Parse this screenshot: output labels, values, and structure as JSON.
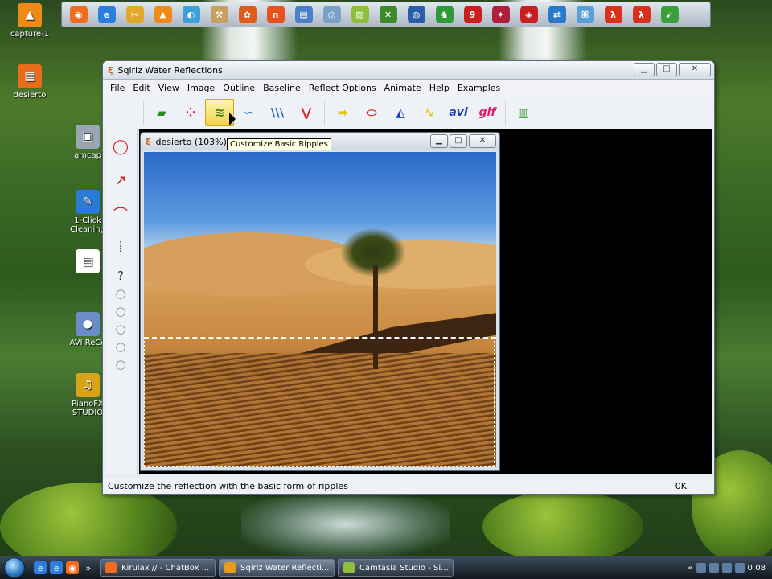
{
  "desktop": {
    "icons": [
      {
        "label": "capture-1",
        "glyph": "▲",
        "color": "#f08a16"
      },
      {
        "label": "desierto",
        "glyph": "▦",
        "color": "#e86c1a"
      },
      {
        "label": "amcap",
        "glyph": "▣",
        "color": "#9aa6b2"
      },
      {
        "label": "1-Click Cleaning",
        "glyph": "✎",
        "color": "#2a7ad6"
      },
      {
        "label": "",
        "glyph": "▤",
        "color": "#ffffff"
      },
      {
        "label": "AVI ReCo",
        "glyph": "●",
        "color": "#6a8cc7"
      },
      {
        "label": "PianoFX STUDIO",
        "glyph": "♫",
        "color": "#d9a21b"
      }
    ]
  },
  "dock": {
    "icons": [
      {
        "name": "firefox-icon",
        "glyph": "◉",
        "color": "#f06d1f"
      },
      {
        "name": "internet-explorer-icon",
        "glyph": "e",
        "color": "#2c7de0"
      },
      {
        "name": "tools-icon",
        "glyph": "✂",
        "color": "#e0a92c"
      },
      {
        "name": "vlc-icon",
        "glyph": "▲",
        "color": "#f08a16"
      },
      {
        "name": "media-icon",
        "glyph": "◐",
        "color": "#3aa0d8"
      },
      {
        "name": "hammer-icon",
        "glyph": "⚒",
        "color": "#c8a060"
      },
      {
        "name": "paw-icon",
        "glyph": "✿",
        "color": "#e05c1a"
      },
      {
        "name": "nero-icon",
        "glyph": "n",
        "color": "#e8501c"
      },
      {
        "name": "document-icon",
        "glyph": "▤",
        "color": "#4d7fc8"
      },
      {
        "name": "clip-icon",
        "glyph": "◎",
        "color": "#7aa0c8"
      },
      {
        "name": "notes-icon",
        "glyph": "▧",
        "color": "#8dbf3a"
      },
      {
        "name": "xbox-icon",
        "glyph": "✕",
        "color": "#3c8a2a"
      },
      {
        "name": "earth-icon",
        "glyph": "◍",
        "color": "#2a5ea8"
      },
      {
        "name": "chess-icon",
        "glyph": "♞",
        "color": "#2f9a3a"
      },
      {
        "name": "we9-icon",
        "glyph": "9",
        "color": "#c81e1e"
      },
      {
        "name": "puzzle-icon",
        "glyph": "✦",
        "color": "#b01e3c"
      },
      {
        "name": "game-icon",
        "glyph": "◈",
        "color": "#c81e1e"
      },
      {
        "name": "teamviewer-icon",
        "glyph": "⇄",
        "color": "#2a78c8"
      },
      {
        "name": "network-icon",
        "glyph": "⌘",
        "color": "#5aa0d8"
      },
      {
        "name": "half-life-icon",
        "glyph": "λ",
        "color": "#d8301c"
      },
      {
        "name": "half-life-2-icon",
        "glyph": "λ",
        "color": "#d8301c"
      },
      {
        "name": "arrow-app-icon",
        "glyph": "➹",
        "color": "#3aa03a"
      }
    ]
  },
  "window": {
    "title": "Sqirlz Water Reflections",
    "menu": [
      "File",
      "Edit",
      "View",
      "Image",
      "Outline",
      "Baseline",
      "Reflect Options",
      "Animate",
      "Help",
      "Examples"
    ],
    "toolbar": [
      {
        "name": "open-folder-button",
        "glyph": "▰",
        "color": "#2e8a22"
      },
      {
        "name": "points-button",
        "glyph": "⁘",
        "color": "#d02828"
      },
      {
        "name": "basic-ripples-button",
        "glyph": "≋",
        "color": "#2e7a1a",
        "active": true
      },
      {
        "name": "ripples-button",
        "glyph": "∽",
        "color": "#2a68c8"
      },
      {
        "name": "waves-button",
        "glyph": "\\\\\\",
        "color": "#2a68c8"
      },
      {
        "name": "rays-button",
        "glyph": "⋁",
        "color": "#d02828"
      },
      {
        "name": "arrow-right-button",
        "glyph": "➡",
        "color": "#e8c800"
      },
      {
        "name": "reflection-button",
        "glyph": "⬭",
        "color": "#c82828"
      },
      {
        "name": "triangle-button",
        "glyph": "◭",
        "color": "#1a3eb8"
      },
      {
        "name": "wave-yellow-button",
        "glyph": "∿",
        "color": "#e8c800"
      },
      {
        "name": "avi-button",
        "glyph": "avi",
        "color": "#1a3eb8"
      },
      {
        "name": "gif-button",
        "glyph": "gif",
        "color": "#d81e6c"
      },
      {
        "name": "panel-button",
        "glyph": "▥",
        "color": "#3aa03a"
      }
    ],
    "lefttools": [
      {
        "name": "ellipse-tool",
        "glyph": "◯",
        "color": "#d02828"
      },
      {
        "name": "line-tool",
        "glyph": "↗",
        "color": "#c02828"
      },
      {
        "name": "curve-tool",
        "glyph": "⌒",
        "color": "#c02828"
      },
      {
        "name": "zigzag-tool",
        "glyph": "⦚",
        "color": "#333333"
      },
      {
        "name": "help-shape-tool",
        "glyph": "?",
        "color": "#333333"
      },
      {
        "name": "shape-tool-1",
        "glyph": "○",
        "color": "#888888"
      },
      {
        "name": "shape-tool-2",
        "glyph": "○",
        "color": "#888888"
      },
      {
        "name": "shape-tool-3",
        "glyph": "○",
        "color": "#888888"
      },
      {
        "name": "shape-tool-4",
        "glyph": "○",
        "color": "#888888"
      },
      {
        "name": "shape-tool-5",
        "glyph": "○",
        "color": "#888888"
      }
    ],
    "child": {
      "title": "desierto (103%)"
    },
    "tooltip": "Customize Basic Ripples",
    "status": {
      "text": "Customize the reflection with the basic form of ripples",
      "right": "0K"
    }
  },
  "taskbar": {
    "tasks": [
      {
        "label": "Kirulax // - ChatBox ...",
        "color": "#f06d1f"
      },
      {
        "label": "Sqirlz Water Reflecti...",
        "color": "#e89d1a",
        "active": true
      },
      {
        "label": "Camtasia Studio - Si...",
        "color": "#8dbf3a"
      }
    ],
    "clock": "0:08"
  }
}
